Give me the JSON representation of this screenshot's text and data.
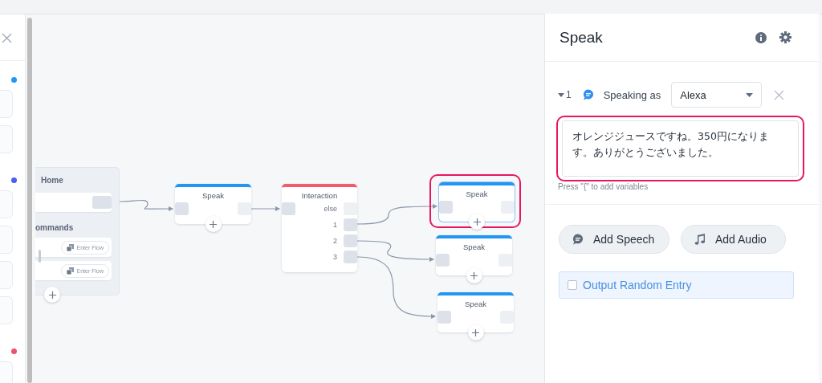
{
  "sidebar": {
    "sections": [
      {
        "color": "#2196f3",
        "cards": [
          {
            "kind": "card"
          },
          {
            "kind": "card"
          }
        ]
      },
      {
        "color": "#4a5ff0",
        "cards": [
          {
            "kind": "card"
          },
          {
            "kind": "card"
          },
          {
            "kind": "card"
          },
          {
            "kind": "card"
          }
        ]
      },
      {
        "color": "#f0506e",
        "cards": [
          {
            "kind": "card"
          }
        ]
      }
    ]
  },
  "canvas": {
    "nodes": [
      {
        "kind": "block",
        "title": "Home",
        "commands_label": "ommands",
        "commands": [
          {
            "action": "Enter Flow"
          },
          {
            "action": "Enter Flow"
          }
        ]
      },
      {
        "kind": "speak",
        "title": "Speak",
        "highlighted": false
      },
      {
        "kind": "interaction",
        "title": "Interaction",
        "ports": [
          "else",
          "1",
          "2",
          "3"
        ]
      },
      {
        "kind": "speak",
        "title": "Speak",
        "highlighted": true
      },
      {
        "kind": "speak",
        "title": "Speak",
        "highlighted": false
      },
      {
        "kind": "speak",
        "title": "Speak",
        "highlighted": false
      }
    ]
  },
  "panel": {
    "title": "Speak",
    "entries": [
      {
        "index": "1",
        "expanded": true,
        "label": "Speaking as",
        "voice": "Alexa",
        "text": "オレンジジュースですね。350円になります。ありがとうございました。",
        "highlighted": true
      }
    ],
    "hint": "Press \"{\" to add variables",
    "buttons": [
      {
        "kind": "speech",
        "label": "Add Speech"
      },
      {
        "kind": "audio",
        "label": "Add Audio"
      }
    ],
    "random_output": {
      "label": "Output Random Entry",
      "checked": false
    }
  }
}
